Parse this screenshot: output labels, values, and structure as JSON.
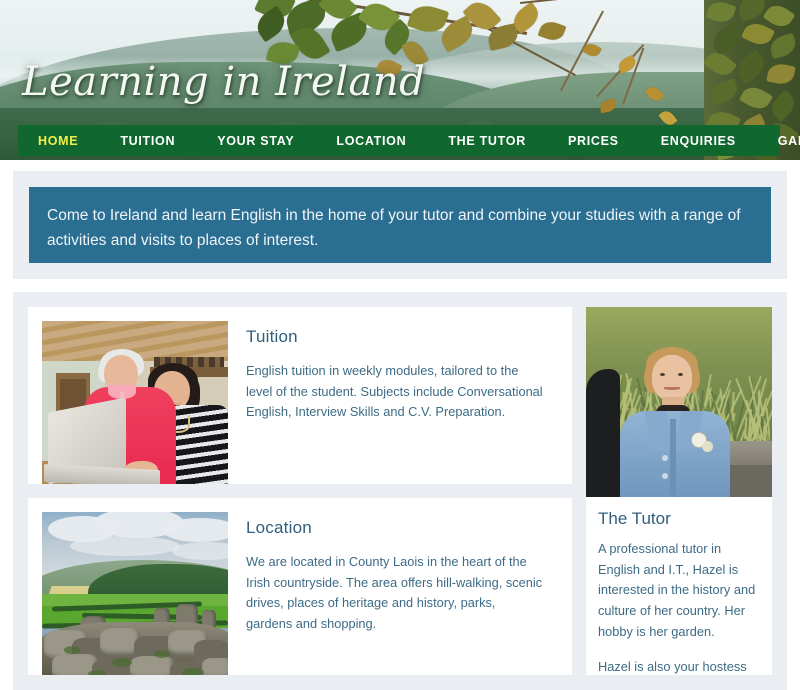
{
  "site": {
    "title": "Learning in Ireland"
  },
  "nav": {
    "items": [
      {
        "label": "HOME",
        "active": true
      },
      {
        "label": "TUITION",
        "active": false
      },
      {
        "label": "YOUR STAY",
        "active": false
      },
      {
        "label": "LOCATION",
        "active": false
      },
      {
        "label": "THE TUTOR",
        "active": false
      },
      {
        "label": "PRICES",
        "active": false
      },
      {
        "label": "ENQUIRIES",
        "active": false
      },
      {
        "label": "GALLERY",
        "active": false
      }
    ]
  },
  "intro": {
    "text": "Come to Ireland and learn English in the home of your tutor and combine your studies with a range of activities and visits to places of interest."
  },
  "sections": [
    {
      "heading": "Tuition",
      "text": "English tuition in weekly modules, tailored to the level of the student. Subjects include Conversational English, Interview Skills and C.V. Preparation.",
      "photo_alt": "two-women-at-laptop-photo"
    },
    {
      "heading": "Location",
      "text": "We are located in County Laois in the heart of the Irish countryside. The area offers hill-walking, scenic drives, places of heritage and history, parks, gardens and shopping.",
      "photo_alt": "irish-countryside-ruins-photo"
    }
  ],
  "sidebar": {
    "heading": "The Tutor",
    "photo_alt": "tutor-portrait-photo",
    "paragraphs": [
      "A professional tutor in English and I.T., Hazel is interested in the history and culture of her country. Her hobby is her garden.",
      "Hazel is also your hostess"
    ]
  },
  "colors": {
    "nav_green": "#10682f",
    "nav_active_yellow": "#f2ef4a",
    "banner_blue": "#2a6e92",
    "heading_blue": "#2f5f7d",
    "body_blue": "#3d6b86",
    "panel_grey": "#eaeef2"
  }
}
